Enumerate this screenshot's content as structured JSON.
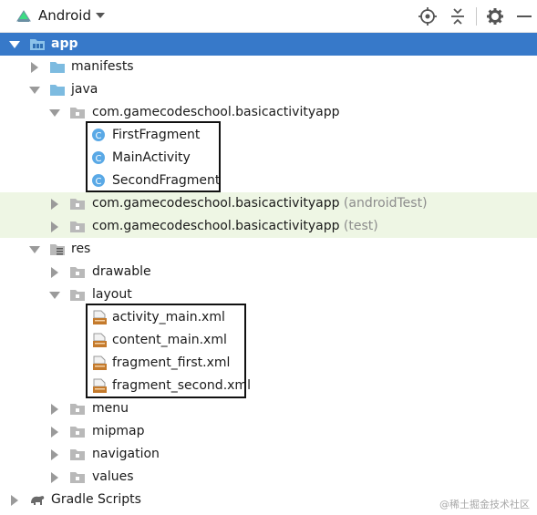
{
  "toolbar": {
    "title": "Android",
    "buttons": [
      "locate-icon",
      "collapse-icon",
      "gear-icon",
      "minimize-icon"
    ]
  },
  "tree": [
    {
      "label": "app",
      "extra": "",
      "icon": "module-folder-icon",
      "state": "expanded",
      "selected": true
    },
    {
      "label": "manifests",
      "extra": "",
      "icon": "folder-icon",
      "state": "collapsed"
    },
    {
      "label": "java",
      "extra": "",
      "icon": "folder-icon",
      "state": "expanded"
    },
    {
      "label": "com.gamecodeschool.basicactivityapp",
      "extra": "",
      "icon": "package-icon",
      "state": "expanded"
    },
    {
      "label": "FirstFragment",
      "extra": "",
      "icon": "class-icon"
    },
    {
      "label": "MainActivity",
      "extra": "",
      "icon": "class-icon"
    },
    {
      "label": "SecondFragment",
      "extra": "",
      "icon": "class-icon"
    },
    {
      "label": "com.gamecodeschool.basicactivityapp",
      "extra": "(androidTest)",
      "icon": "package-icon",
      "state": "collapsed"
    },
    {
      "label": "com.gamecodeschool.basicactivityapp",
      "extra": "(test)",
      "icon": "package-icon",
      "state": "collapsed"
    },
    {
      "label": "res",
      "extra": "",
      "icon": "res-folder-icon",
      "state": "expanded"
    },
    {
      "label": "drawable",
      "extra": "",
      "icon": "package-icon",
      "state": "collapsed"
    },
    {
      "label": "layout",
      "extra": "",
      "icon": "package-icon",
      "state": "expanded"
    },
    {
      "label": "activity_main.xml",
      "extra": "",
      "icon": "layout-file-icon"
    },
    {
      "label": "content_main.xml",
      "extra": "",
      "icon": "layout-file-icon"
    },
    {
      "label": "fragment_first.xml",
      "extra": "",
      "icon": "layout-file-icon"
    },
    {
      "label": "fragment_second.xml",
      "extra": "",
      "icon": "layout-file-icon"
    },
    {
      "label": "menu",
      "extra": "",
      "icon": "package-icon",
      "state": "collapsed"
    },
    {
      "label": "mipmap",
      "extra": "",
      "icon": "package-icon",
      "state": "collapsed"
    },
    {
      "label": "navigation",
      "extra": "",
      "icon": "package-icon",
      "state": "collapsed"
    },
    {
      "label": "values",
      "extra": "",
      "icon": "package-icon",
      "state": "collapsed"
    },
    {
      "label": "Gradle Scripts",
      "extra": "",
      "icon": "gradle-icon",
      "state": "collapsed"
    }
  ],
  "watermark": "@稀土掘金技术社区",
  "colors": {
    "selection": "#3779c9",
    "test_row_tint": "#eef6e4",
    "folder": "#7dbbe0",
    "class_icon": "#5aa9e6"
  }
}
